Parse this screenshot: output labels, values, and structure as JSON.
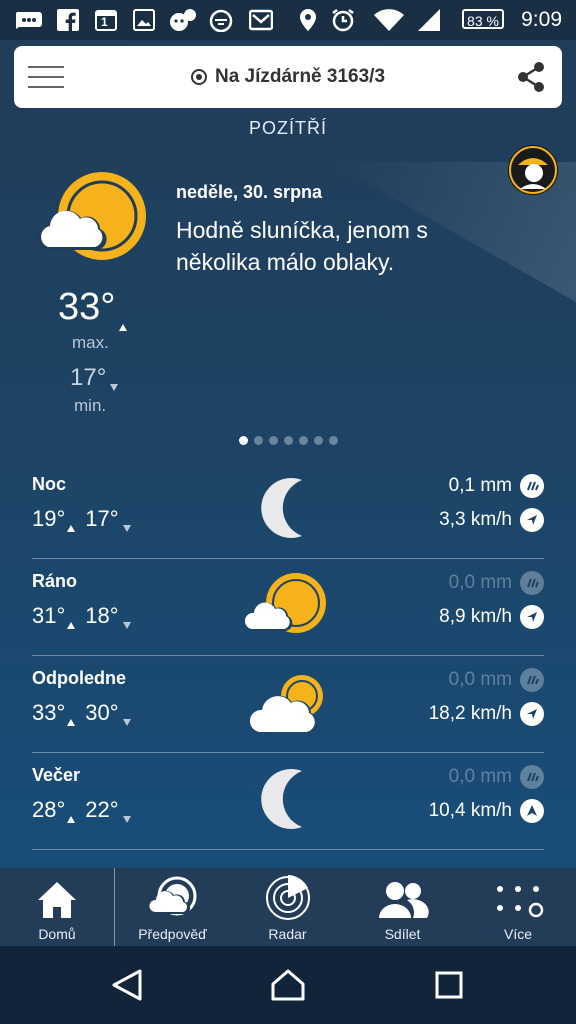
{
  "status_bar": {
    "battery": "83 %",
    "time": "9:09",
    "calendar_day": "1"
  },
  "header": {
    "location": "Na Jízdárně 3163/3",
    "day_label": "POZÍTŘÍ"
  },
  "forecast": {
    "date": "neděle, 30. srpna",
    "description": "Hodně sluníčka, jenom s několika málo oblaky.",
    "max_temp": "33°",
    "max_label": "max.",
    "min_temp": "17°",
    "min_label": "min.",
    "page_count": 7,
    "active_page": 1
  },
  "periods": [
    {
      "name": "Noc",
      "high": "19°",
      "low": "17°",
      "rain": "0,1 mm",
      "rain_dim": false,
      "wind": "3,3 km/h",
      "icon": "moon-icon"
    },
    {
      "name": "Ráno",
      "high": "31°",
      "low": "18°",
      "rain": "0,0 mm",
      "rain_dim": true,
      "wind": "8,9 km/h",
      "icon": "sun-cloud-icon"
    },
    {
      "name": "Odpoledne",
      "high": "33°",
      "low": "30°",
      "rain": "0,0 mm",
      "rain_dim": true,
      "wind": "18,2 km/h",
      "icon": "cloud-sun-icon"
    },
    {
      "name": "Večer",
      "high": "28°",
      "low": "22°",
      "rain": "0,0 mm",
      "rain_dim": true,
      "wind": "10,4 km/h",
      "icon": "moon-icon"
    }
  ],
  "nav": {
    "home": "Domů",
    "forecast": "Předpověď",
    "radar": "Radar",
    "share": "Sdílet",
    "more": "Více"
  },
  "colors": {
    "sun": "#f5b21a",
    "background_top": "#213c58",
    "background_bottom": "#17507e"
  }
}
